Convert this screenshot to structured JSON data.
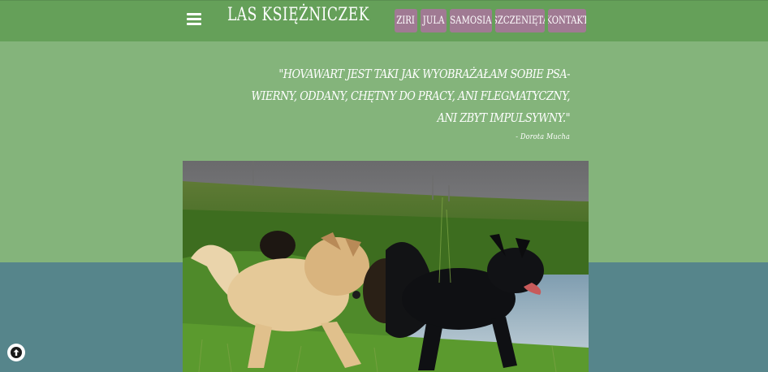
{
  "header": {
    "menu_icon": "hamburger-menu-icon",
    "title": "LAS KSIĘŻNICZEK",
    "nav": [
      {
        "label": "ziri"
      },
      {
        "label": "jula"
      },
      {
        "label": "samosia"
      },
      {
        "label": "szczenięta"
      },
      {
        "label": "kontakt"
      }
    ]
  },
  "quote": {
    "text_line1": "\"Hovawart jest taki jak wyobrażałam sobie psa-",
    "text_line2": "wierny, oddany, chętny do pracy, ani flegmatyczny, ani zbyt impulsywny.\"",
    "author": "- Dorota Mucha"
  },
  "photo": {
    "icon": "dogs-running-photo"
  },
  "scroll_top": {
    "icon": "arrow-up-circle-icon"
  },
  "colors": {
    "header_bg": "#65a059",
    "page_bg": "#84b47b",
    "lower_band": "#56858b",
    "nav_button": "#a07a93"
  }
}
